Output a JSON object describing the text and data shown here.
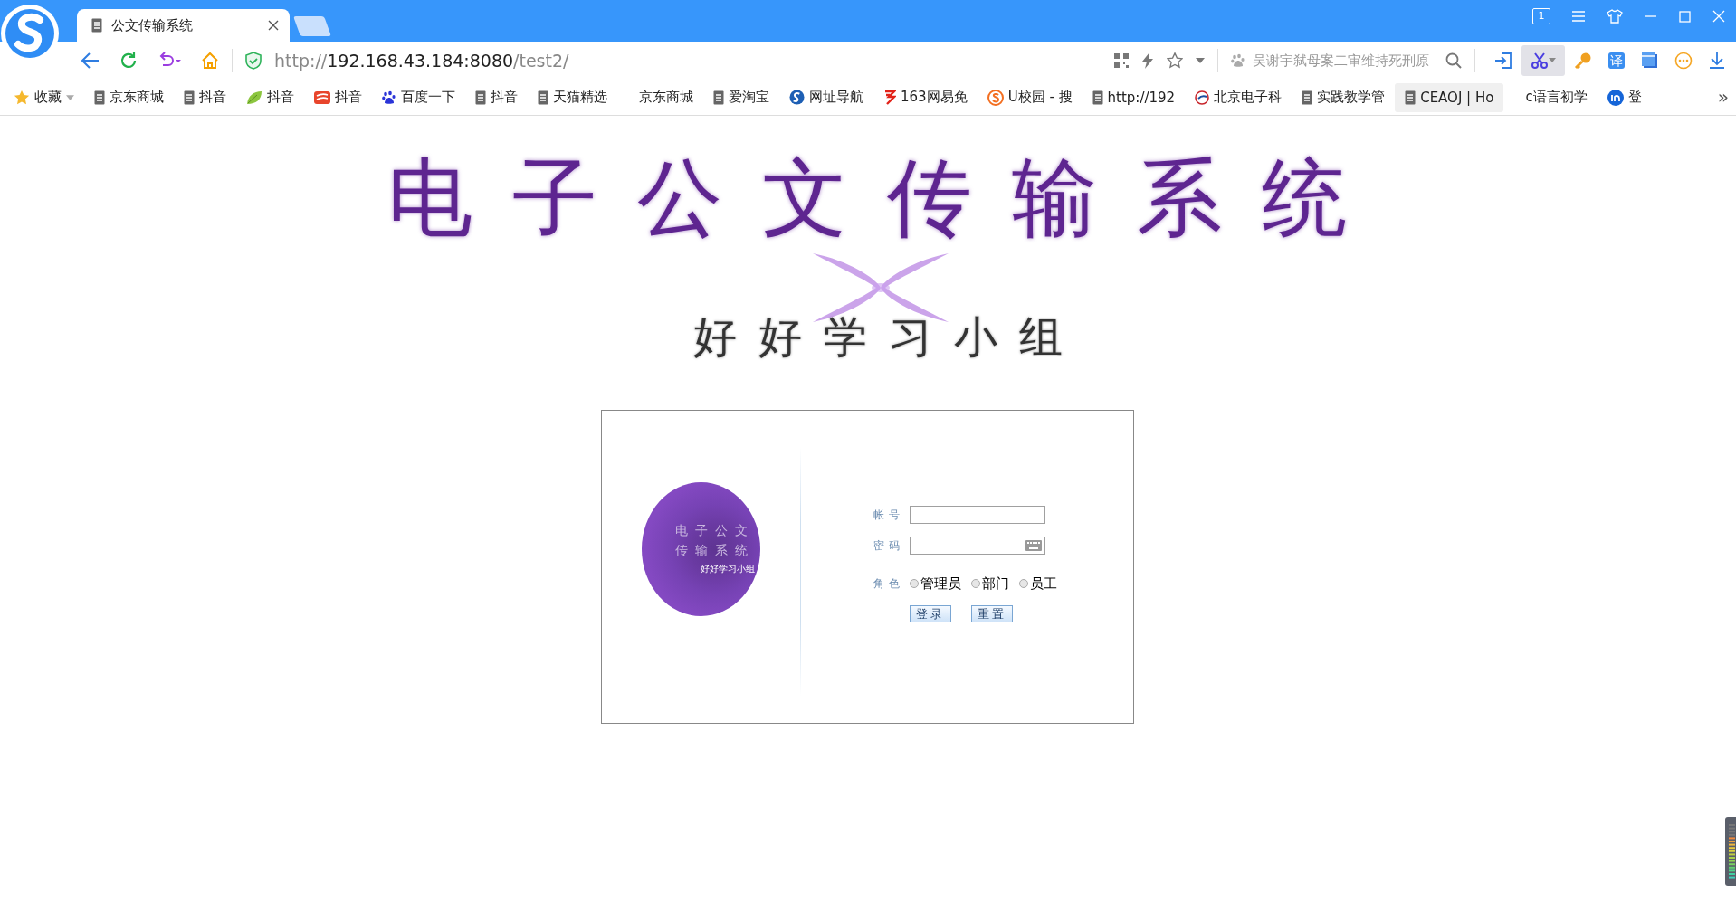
{
  "browser": {
    "tab": {
      "title": "公文传输系统",
      "selected": true
    },
    "window_count": "1",
    "address": {
      "scheme": "http://",
      "host": "192.168.43.184:8080",
      "path": "/test2/"
    },
    "search": {
      "placeholder": "吴谢宇弑母案二审维持死刑原"
    },
    "tools": [
      {
        "kind": "login",
        "pressed": false
      },
      {
        "kind": "scissors",
        "pressed": true
      },
      {
        "kind": "key",
        "pressed": false
      },
      {
        "kind": "translate",
        "label": "译",
        "pressed": false
      },
      {
        "kind": "window",
        "pressed": false
      },
      {
        "kind": "more",
        "pressed": false
      },
      {
        "kind": "download",
        "pressed": false
      }
    ],
    "bookmarks": [
      {
        "label": "收藏",
        "kind": "star",
        "hovered": false
      },
      {
        "label": "京东商城",
        "kind": "page",
        "hovered": false
      },
      {
        "label": "抖音",
        "kind": "page",
        "hovered": false
      },
      {
        "label": "抖音",
        "kind": "leaf",
        "hovered": false
      },
      {
        "label": "抖音",
        "kind": "stripes",
        "hovered": false
      },
      {
        "label": "百度一下",
        "kind": "paw",
        "hovered": false
      },
      {
        "label": "抖音",
        "kind": "page",
        "hovered": false
      },
      {
        "label": "天猫精选",
        "kind": "page",
        "hovered": false
      },
      {
        "label": "京东商城",
        "kind": "none",
        "hovered": false
      },
      {
        "label": "爱淘宝",
        "kind": "page",
        "hovered": false
      },
      {
        "label": "网址导航",
        "kind": "swirl",
        "hovered": false
      },
      {
        "label": "163网易免",
        "kind": "red-mark",
        "hovered": false
      },
      {
        "label": "U校园 - 搜",
        "kind": "orange-s",
        "hovered": false
      },
      {
        "label": "http://192",
        "kind": "page",
        "hovered": false
      },
      {
        "label": "北京电子科",
        "kind": "ring",
        "hovered": false
      },
      {
        "label": "实践教学管",
        "kind": "page",
        "hovered": false
      },
      {
        "label": "CEAOJ | Ho",
        "kind": "page",
        "hovered": true
      },
      {
        "label": "c语言初学",
        "kind": "none",
        "hovered": false
      },
      {
        "label": "登",
        "kind": "blue-in",
        "hovered": false
      }
    ],
    "overflow": "»"
  },
  "page": {
    "title": "电子公文传输系统",
    "subtitle": "好好学习小组",
    "logo": {
      "line_1": "电子公文",
      "line_2": "传输系统",
      "caption": "好好学习小组"
    },
    "form": {
      "account_label": "帐号",
      "password_label": "密码",
      "role_label": "角色",
      "roles": [
        {
          "label": "管理员",
          "selected": false
        },
        {
          "label": "部门",
          "selected": false
        },
        {
          "label": "员工",
          "selected": false
        }
      ],
      "buttons": [
        "登录",
        "重置"
      ]
    }
  }
}
